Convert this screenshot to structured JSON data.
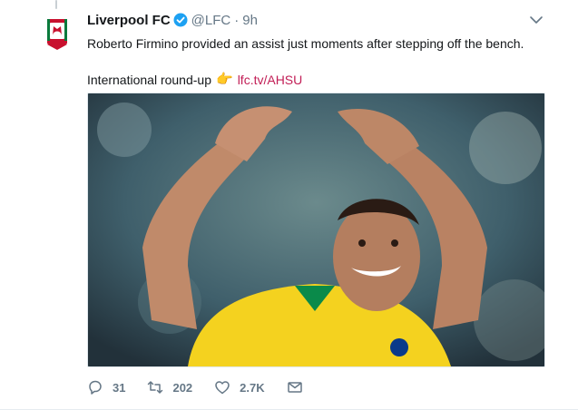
{
  "tweet": {
    "author_name": "Liverpool FC",
    "handle": "@LFC",
    "separator": "·",
    "time": "9h",
    "text_line1": "Roberto Firmino provided an assist just moments after stepping off the bench.",
    "text_line2_prefix": "International round-up",
    "emoji": "👉",
    "link_text": "lfc.tv/AHSU"
  },
  "actions": {
    "replies": "31",
    "retweets": "202",
    "likes": "2.7K"
  },
  "colors": {
    "link": "#c21e56",
    "verified": "#1da1f2",
    "muted": "#657786",
    "jersey": "#f4d21f"
  },
  "icons": {
    "avatar": "liverpool-crest-icon",
    "verified": "verified-badge-icon",
    "menu": "chevron-down-icon",
    "reply": "reply-icon",
    "retweet": "retweet-icon",
    "like": "heart-icon",
    "message": "direct-message-icon"
  }
}
